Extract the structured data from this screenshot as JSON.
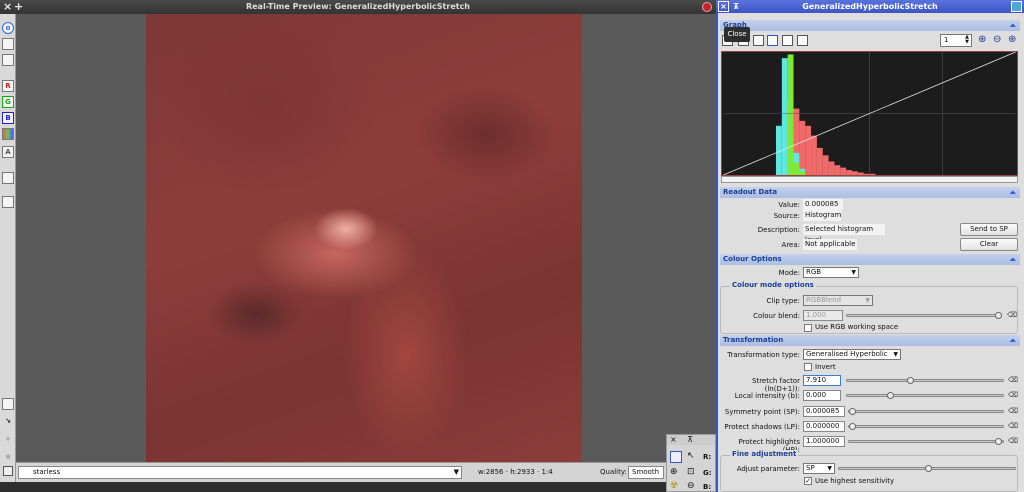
{
  "preview": {
    "title": "Real-Time Preview: GeneralizedHyperbolicStretch",
    "close_icon": "×",
    "add_icon": "+",
    "view_name": "starless",
    "dimensions": "w:2856 · h:2933 · 1:4",
    "quality_label": "Quality:",
    "quality_value": "Smooth",
    "left_toolbar": [
      "R",
      "G",
      "B",
      "A"
    ]
  },
  "mini": {
    "labels": [
      "R:",
      "G:",
      "B:"
    ]
  },
  "process": {
    "title": "GeneralizedHyperbolicStretch",
    "tooltip": "Close",
    "graph": {
      "section": "Graph",
      "zoom": "1",
      "histogram": {
        "bins_x": [
          0.16,
          0.18,
          0.2,
          0.22,
          0.24,
          0.26,
          0.28,
          0.3,
          0.32,
          0.34,
          0.36,
          0.38,
          0.4,
          0.42,
          0.44,
          0.46,
          0.48,
          0.5
        ],
        "cyan": [
          0,
          40,
          95,
          62,
          18,
          5,
          0,
          0,
          0,
          0,
          0,
          0,
          0,
          0,
          0,
          0,
          0,
          0
        ],
        "green": [
          0,
          0,
          0,
          98,
          10,
          3,
          0,
          0,
          0,
          0,
          0,
          0,
          0,
          0,
          0,
          0,
          0,
          0
        ],
        "red": [
          0,
          0,
          0,
          8,
          54,
          44,
          40,
          32,
          22,
          16,
          11,
          8,
          6,
          4,
          3,
          2,
          1,
          1
        ],
        "colors": {
          "cyan": "#5ee6e0",
          "green": "#7bea3a",
          "red": "#f06a6a",
          "blue": "#6a6cf0",
          "yellow": "#e6ea4a",
          "grey": "#8a8a8a"
        }
      }
    },
    "readout": {
      "section": "Readout Data",
      "value_label": "Value:",
      "value": "0.000085",
      "source_label": "Source:",
      "source": "Histogram",
      "description_label": "Description:",
      "description": "Selected histogram level",
      "area_label": "Area:",
      "area": "Not applicable",
      "send_button": "Send to SP",
      "clear_button": "Clear"
    },
    "colour": {
      "section": "Colour Options",
      "mode_label": "Mode:",
      "mode": "RGB",
      "group_title": "Colour mode options",
      "clip_label": "Clip type:",
      "clip": "RGBBlend",
      "blend_label": "Colour blend:",
      "blend": "1.000",
      "working_space": "Use RGB working space"
    },
    "transform": {
      "section": "Transformation",
      "type_label": "Transformation type:",
      "type": "Generalised Hyperbolic",
      "invert": "Invert",
      "stretch_label": "Stretch factor (ln(D+1)):",
      "stretch": "7.910",
      "local_label": "Local intensity (b):",
      "local": "0.000",
      "sp_label": "Symmetry point (SP):",
      "sp": "0.000085",
      "lp_label": "Protect shadows (LP):",
      "lp": "0.000000",
      "hp_label": "Protect highlights (HP):",
      "hp": "1.000000",
      "fine_title": "Fine adjustment",
      "adjust_label": "Adjust parameter:",
      "adjust": "SP",
      "sensitivity": "Use highest sensitivity"
    }
  }
}
